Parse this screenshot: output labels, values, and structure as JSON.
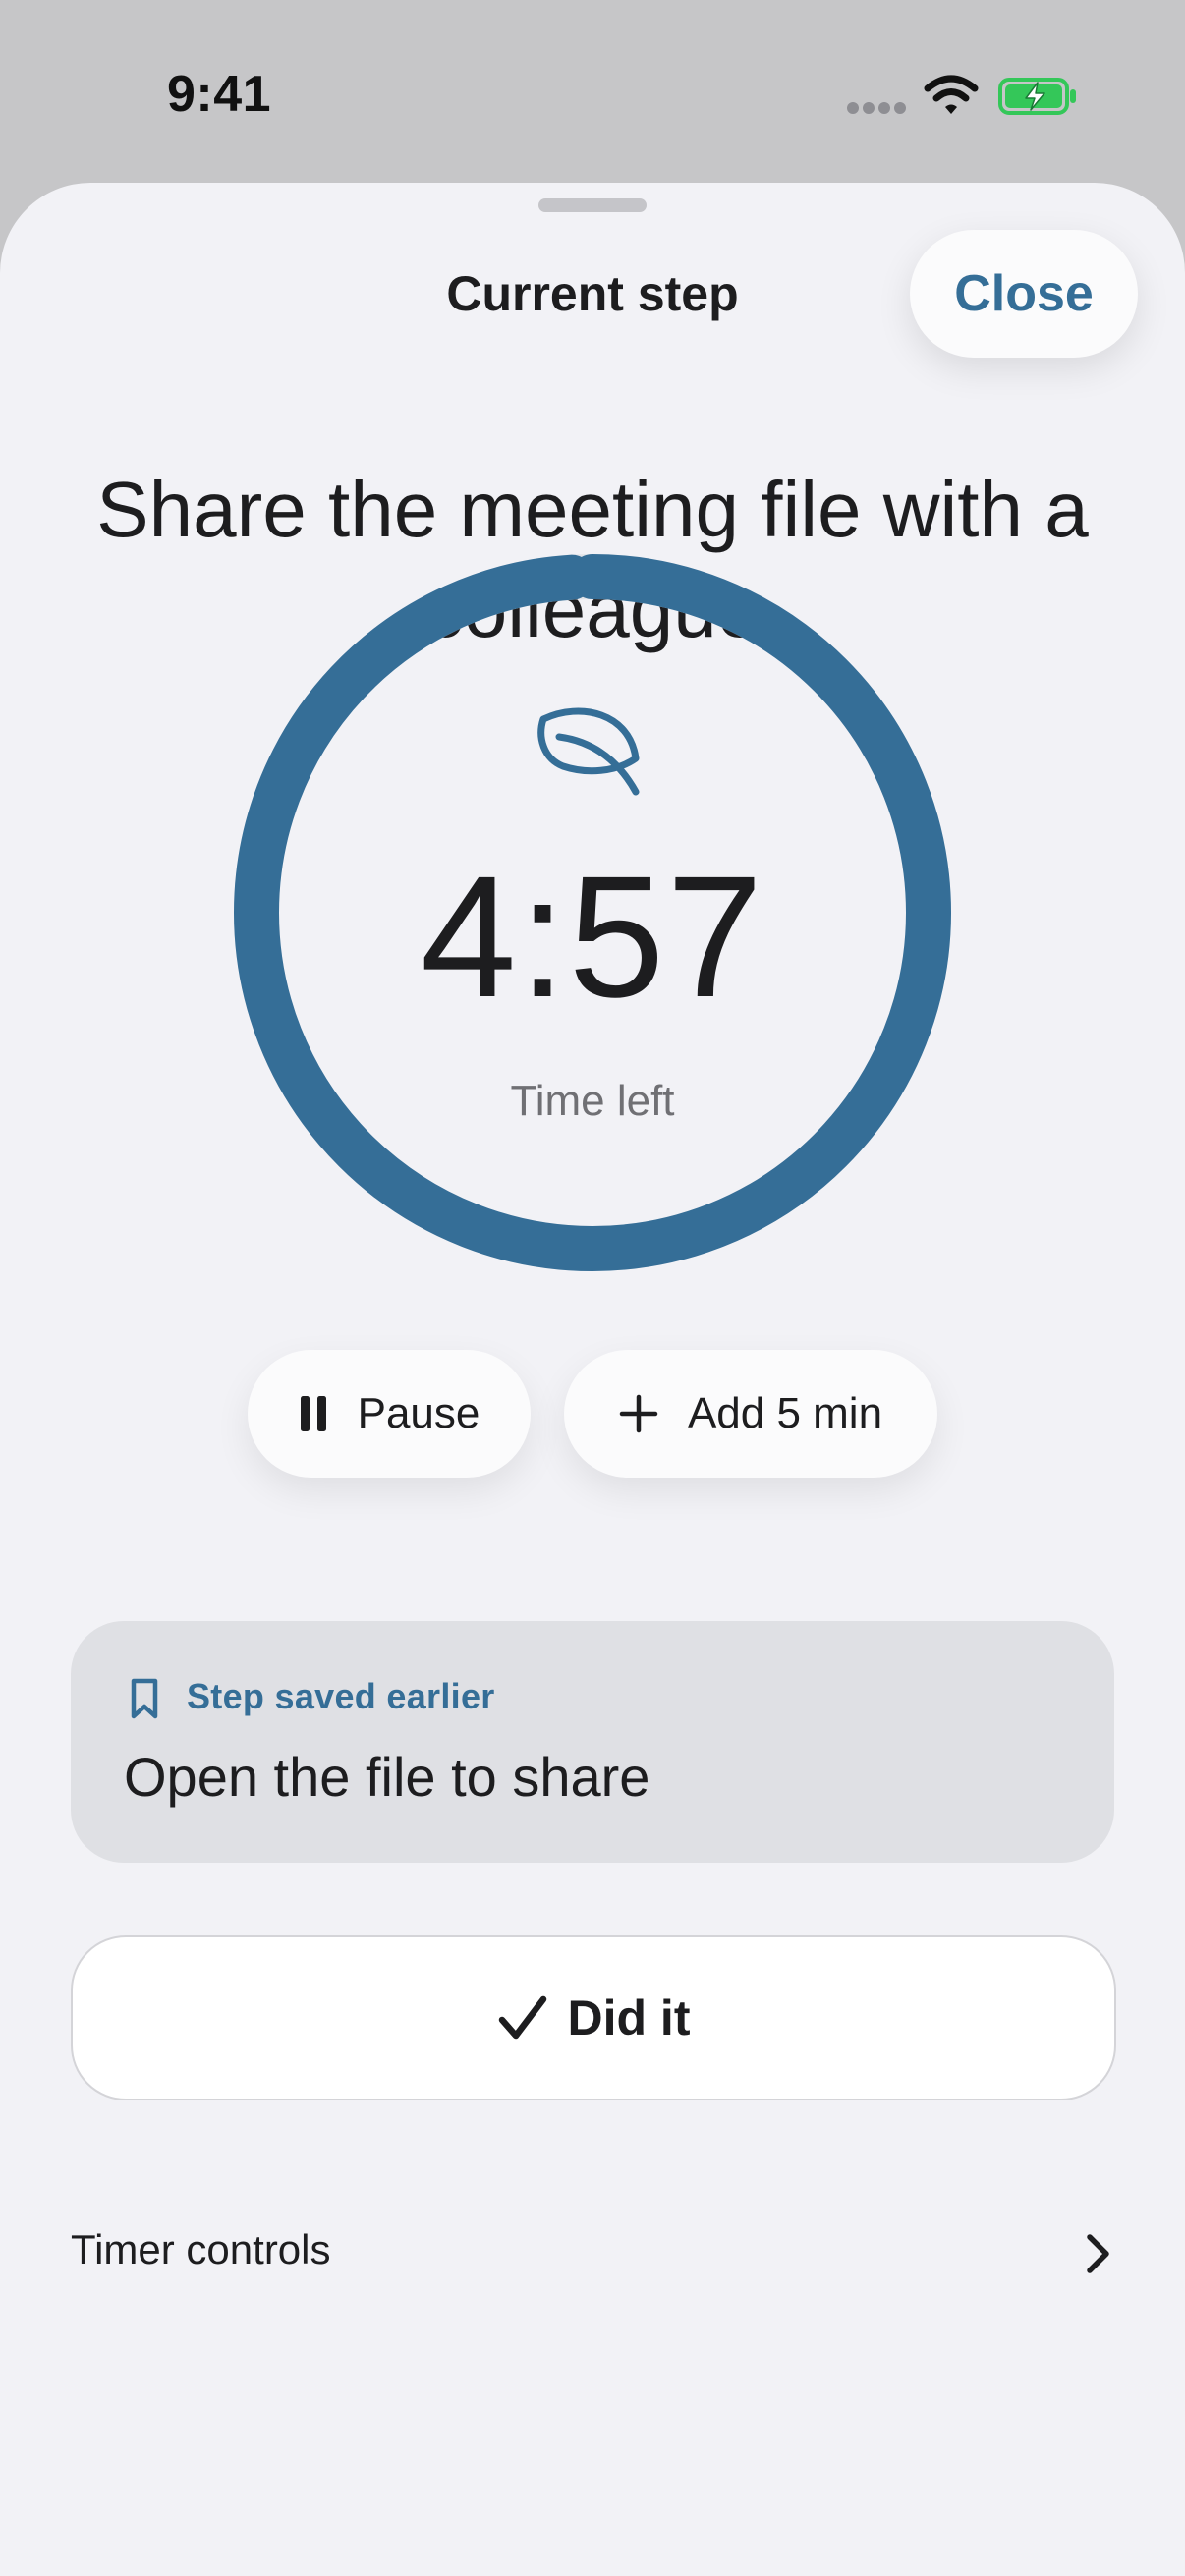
{
  "status_bar": {
    "time": "9:41",
    "icons": [
      "cellular-signal-icon",
      "wifi-icon",
      "battery-charging-icon"
    ]
  },
  "sheet": {
    "title": "Current step",
    "close_label": "Close"
  },
  "task": {
    "title": "Share the meeting file with a colleague"
  },
  "timer": {
    "value": "4:57",
    "label": "Time left",
    "progress_fraction": 0.99,
    "icon": "leaf-icon"
  },
  "controls": {
    "pause_label": "Pause",
    "pause_icon": "pause-icon",
    "add_label": "Add 5 min",
    "add_icon": "plus-icon"
  },
  "saved_step": {
    "caption": "Step saved earlier",
    "icon": "bookmark-icon",
    "text": "Open the file to share"
  },
  "primary_action": {
    "label": "Did it",
    "icon": "checkmark-icon"
  },
  "footer_row": {
    "label": "Timer controls",
    "icon": "chevron-right-icon"
  },
  "colors": {
    "accent": "#356e97",
    "sheet_background": "#f2f2f6",
    "status_bar_background": "#c6c6c8",
    "battery_green": "#34c759"
  }
}
